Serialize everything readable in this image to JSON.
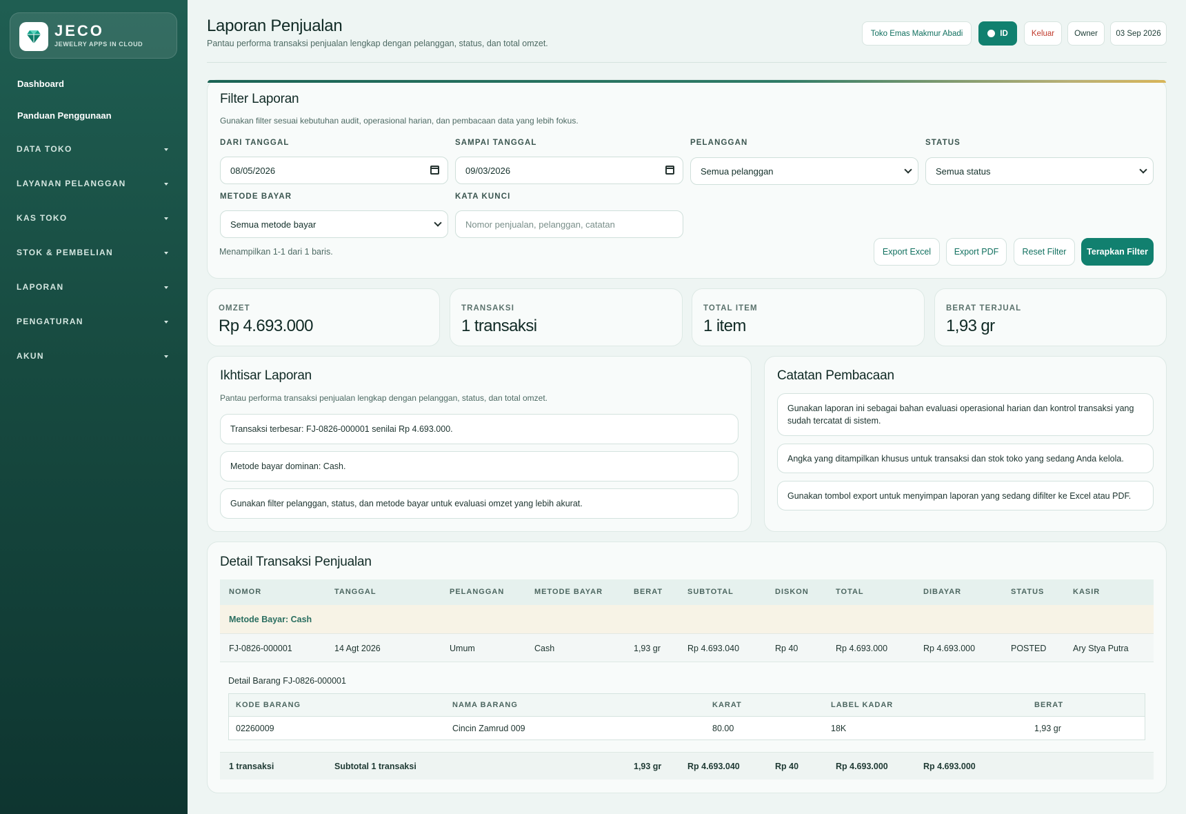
{
  "brand": {
    "name": "JECO",
    "tagline": "JEWELRY APPS IN CLOUD"
  },
  "sidebar": {
    "links": [
      "Dashboard",
      "Panduan Penggunaan"
    ],
    "groups": [
      "DATA TOKO",
      "LAYANAN PELANGGAN",
      "KAS TOKO",
      "STOK & PEMBELIAN",
      "LAPORAN",
      "PENGATURAN",
      "AKUN"
    ]
  },
  "header": {
    "title": "Laporan Penjualan",
    "subtitle": "Pantau performa transaksi penjualan lengkap dengan pelanggan, status, dan total omzet.",
    "store": "Toko Emas Makmur Abadi",
    "lang": "ID",
    "logout": "Keluar",
    "role": "Owner",
    "date": "03 Sep 2026"
  },
  "filter": {
    "title": "Filter Laporan",
    "subtitle": "Gunakan filter sesuai kebutuhan audit, operasional harian, dan pembacaan data yang lebih fokus.",
    "from_label": "DARI TANGGAL",
    "from_value": "08/05/2026",
    "to_label": "SAMPAI TANGGAL",
    "to_value": "09/03/2026",
    "customer_label": "PELANGGAN",
    "customer_value": "Semua pelanggan",
    "status_label": "STATUS",
    "status_value": "Semua status",
    "method_label": "METODE BAYAR",
    "method_value": "Semua metode bayar",
    "keyword_label": "KATA KUNCI",
    "keyword_placeholder": "Nomor penjualan, pelanggan, catatan",
    "rows_info": "Menampilkan 1-1 dari 1 baris.",
    "export_excel": "Export Excel",
    "export_pdf": "Export PDF",
    "reset": "Reset Filter",
    "apply": "Terapkan Filter"
  },
  "kpis": [
    {
      "label": "OMZET",
      "value": "Rp 4.693.000"
    },
    {
      "label": "TRANSAKSI",
      "value": "1 transaksi"
    },
    {
      "label": "TOTAL ITEM",
      "value": "1 item"
    },
    {
      "label": "BERAT TERJUAL",
      "value": "1,93 gr"
    }
  ],
  "overview": {
    "title": "Ikhtisar Laporan",
    "subtitle": "Pantau performa transaksi penjualan lengkap dengan pelanggan, status, dan total omzet.",
    "items": [
      "Transaksi terbesar: FJ-0826-000001 senilai Rp 4.693.000.",
      "Metode bayar dominan: Cash.",
      "Gunakan filter pelanggan, status, dan metode bayar untuk evaluasi omzet yang lebih akurat."
    ]
  },
  "notes": {
    "title": "Catatan Pembacaan",
    "items": [
      "Gunakan laporan ini sebagai bahan evaluasi operasional harian dan kontrol transaksi yang sudah tercatat di sistem.",
      "Angka yang ditampilkan khusus untuk transaksi dan stok toko yang sedang Anda kelola.",
      "Gunakan tombol export untuk menyimpan laporan yang sedang difilter ke Excel atau PDF."
    ]
  },
  "detail": {
    "title": "Detail Transaksi Penjualan",
    "columns": [
      "NOMOR",
      "TANGGAL",
      "PELANGGAN",
      "METODE BAYAR",
      "BERAT",
      "SUBTOTAL",
      "DISKON",
      "TOTAL",
      "DIBAYAR",
      "STATUS",
      "KASIR"
    ],
    "group_label": "Metode Bayar: Cash",
    "row": [
      "FJ-0826-000001",
      "14 Agt 2026",
      "Umum",
      "Cash",
      "1,93 gr",
      "Rp 4.693.040",
      "Rp 40",
      "Rp 4.693.000",
      "Rp 4.693.000",
      "POSTED",
      "Ary Stya Putra"
    ],
    "items_title": "Detail Barang FJ-0826-000001",
    "item_columns": [
      "KODE BARANG",
      "NAMA BARANG",
      "KARAT",
      "LABEL KADAR",
      "BERAT"
    ],
    "item_row": [
      "02260009",
      "Cincin Zamrud 009",
      "80.00",
      "18K",
      "1,93 gr"
    ],
    "footer": [
      "1 transaksi",
      "Subtotal 1 transaksi",
      "1,93 gr",
      "Rp 4.693.040",
      "Rp 40",
      "Rp 4.693.000",
      "Rp 4.693.000"
    ]
  },
  "colors": {
    "primary": "#11806f",
    "sidebar": "#174a40",
    "logout": "#c0392b",
    "group_row": "#f7f3e6"
  }
}
